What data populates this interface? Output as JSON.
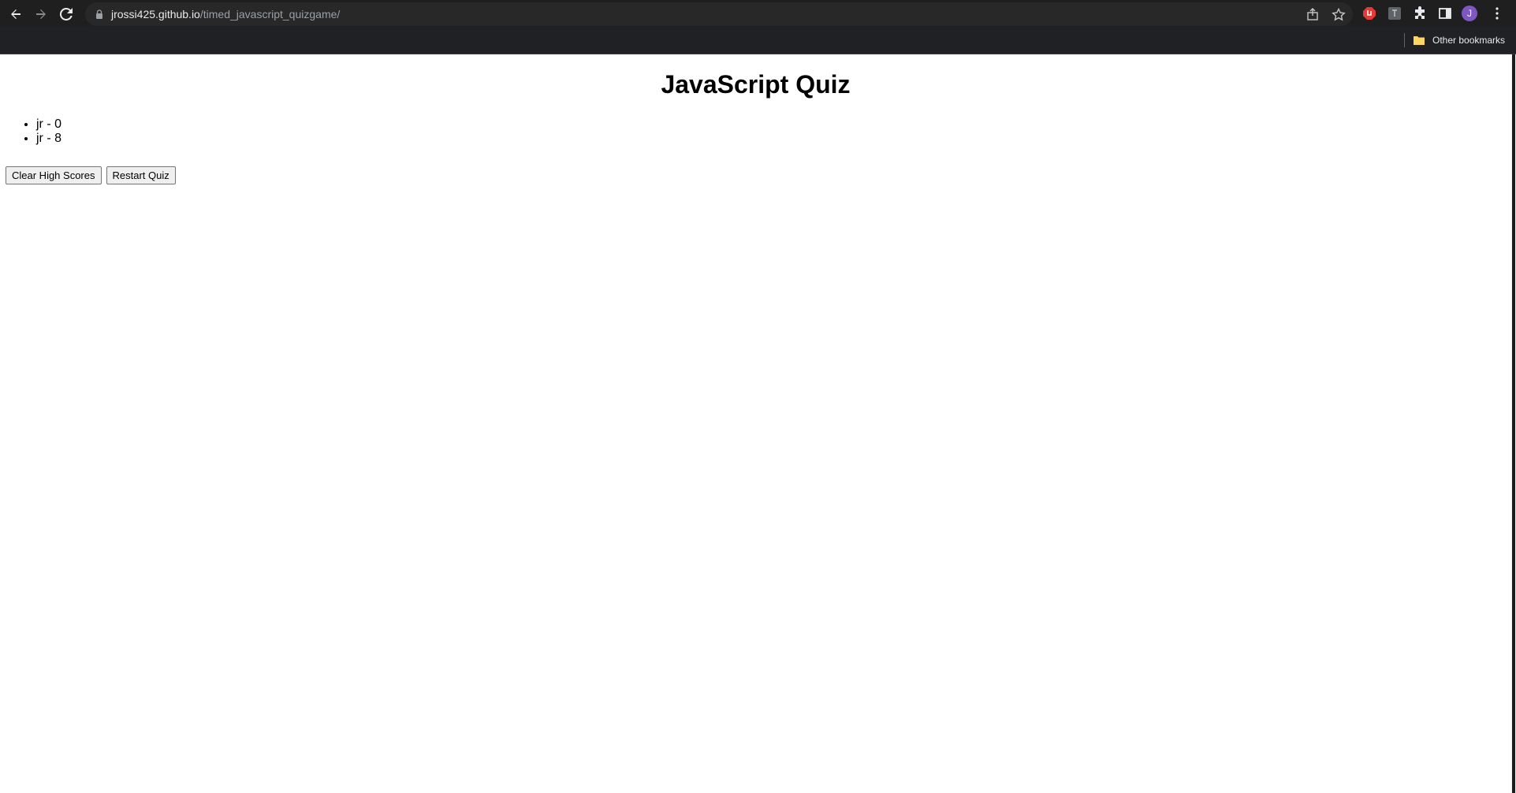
{
  "browser": {
    "url_host": "jrossi425.github.io",
    "url_path": "/timed_javascript_quizgame/",
    "profile_initial": "J",
    "bookmarks": {
      "other_label": "Other bookmarks"
    },
    "colors": {
      "toolbar_bg": "#1f1f1f",
      "omnibox_bg": "#282828",
      "avatar": "#7e57c2",
      "extension_red": "#e53935",
      "folder_yellow": "#fdd663"
    },
    "icons": [
      "back-arrow-icon",
      "forward-arrow-icon",
      "reload-icon",
      "lock-icon",
      "share-icon",
      "star-icon",
      "adblock-extension-icon",
      "extension-icon",
      "puzzle-icon",
      "side-panel-icon",
      "kebab-menu-icon",
      "folder-icon"
    ]
  },
  "page": {
    "title": "JavaScript Quiz",
    "high_scores": [
      {
        "text": "jr - 0"
      },
      {
        "text": "jr - 8"
      }
    ],
    "buttons": {
      "clear_label": "Clear High Scores",
      "restart_label": "Restart Quiz"
    }
  }
}
